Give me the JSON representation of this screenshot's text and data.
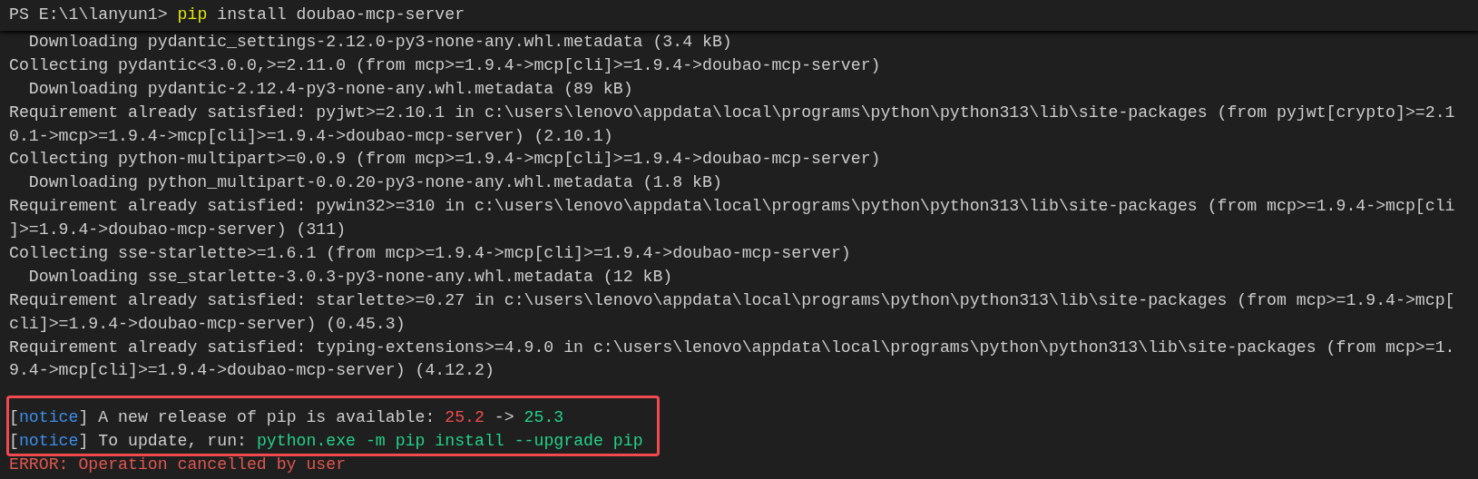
{
  "prompt": {
    "segments": [
      {
        "kind": "text",
        "text": "PS E:\\1\\lanyun1>"
      },
      {
        "kind": "command",
        "text": "pip"
      },
      {
        "kind": "text",
        "text": "install doubao-mcp-server"
      }
    ]
  },
  "output": [
    {
      "kind": "indented",
      "text": "Downloading pydantic_settings-2.12.0-py3-none-any.whl.metadata (3.4 kB)"
    },
    {
      "kind": "plain",
      "text": "Collecting pydantic<3.0.0,>=2.11.0 (from mcp>=1.9.4->mcp[cli]>=1.9.4->doubao-mcp-server)"
    },
    {
      "kind": "indented",
      "text": "Downloading pydantic-2.12.4-py3-none-any.whl.metadata (89 kB)"
    },
    {
      "kind": "plain",
      "text": "Requirement already satisfied: pyjwt>=2.10.1 in c:\\users\\lenovo\\appdata\\local\\programs\\python\\python313\\lib\\site-packages (from pyjwt[crypto]>=2.1"
    },
    {
      "kind": "plain",
      "text": "0.1->mcp>=1.9.4->mcp[cli]>=1.9.4->doubao-mcp-server) (2.10.1)"
    },
    {
      "kind": "plain",
      "text": "Collecting python-multipart>=0.0.9 (from mcp>=1.9.4->mcp[cli]>=1.9.4->doubao-mcp-server)"
    },
    {
      "kind": "indented",
      "text": "Downloading python_multipart-0.0.20-py3-none-any.whl.metadata (1.8 kB)"
    },
    {
      "kind": "plain",
      "text": "Requirement already satisfied: pywin32>=310 in c:\\users\\lenovo\\appdata\\local\\programs\\python\\python313\\lib\\site-packages (from mcp>=1.9.4->mcp[cli"
    },
    {
      "kind": "plain",
      "text": "]>=1.9.4->doubao-mcp-server) (311)"
    },
    {
      "kind": "plain",
      "text": "Collecting sse-starlette>=1.6.1 (from mcp>=1.9.4->mcp[cli]>=1.9.4->doubao-mcp-server)"
    },
    {
      "kind": "indented",
      "text": "Downloading sse_starlette-3.0.3-py3-none-any.whl.metadata (12 kB)"
    },
    {
      "kind": "plain",
      "text": "Requirement already satisfied: starlette>=0.27 in c:\\users\\lenovo\\appdata\\local\\programs\\python\\python313\\lib\\site-packages (from mcp>=1.9.4->mcp["
    },
    {
      "kind": "plain",
      "text": "cli]>=1.9.4->doubao-mcp-server) (0.45.3)"
    },
    {
      "kind": "plain",
      "text": "Requirement already satisfied: typing-extensions>=4.9.0 in c:\\users\\lenovo\\appdata\\local\\programs\\python\\python313\\lib\\site-packages (from mcp>=1."
    },
    {
      "kind": "plain",
      "text": "9.4->mcp[cli]>=1.9.4->doubao-mcp-server) (4.12.2)"
    }
  ],
  "notice_box": {
    "lines": [
      {
        "segments": [
          {
            "kind": "bracket",
            "text": "["
          },
          {
            "kind": "tag",
            "text": "notice"
          },
          {
            "kind": "bracket",
            "text": "]"
          },
          {
            "kind": "text",
            "text": " A new release of pip is available: "
          },
          {
            "kind": "old",
            "text": "25.2"
          },
          {
            "kind": "text",
            "text": " -> "
          },
          {
            "kind": "new",
            "text": "25.3"
          }
        ]
      },
      {
        "segments": [
          {
            "kind": "bracket",
            "text": "["
          },
          {
            "kind": "tag",
            "text": "notice"
          },
          {
            "kind": "bracket",
            "text": "]"
          },
          {
            "kind": "text",
            "text": " To update, run: "
          },
          {
            "kind": "new",
            "text": "python.exe -m pip install --upgrade pip"
          }
        ]
      }
    ]
  },
  "error": {
    "text": "ERROR: Operation cancelled by user"
  }
}
